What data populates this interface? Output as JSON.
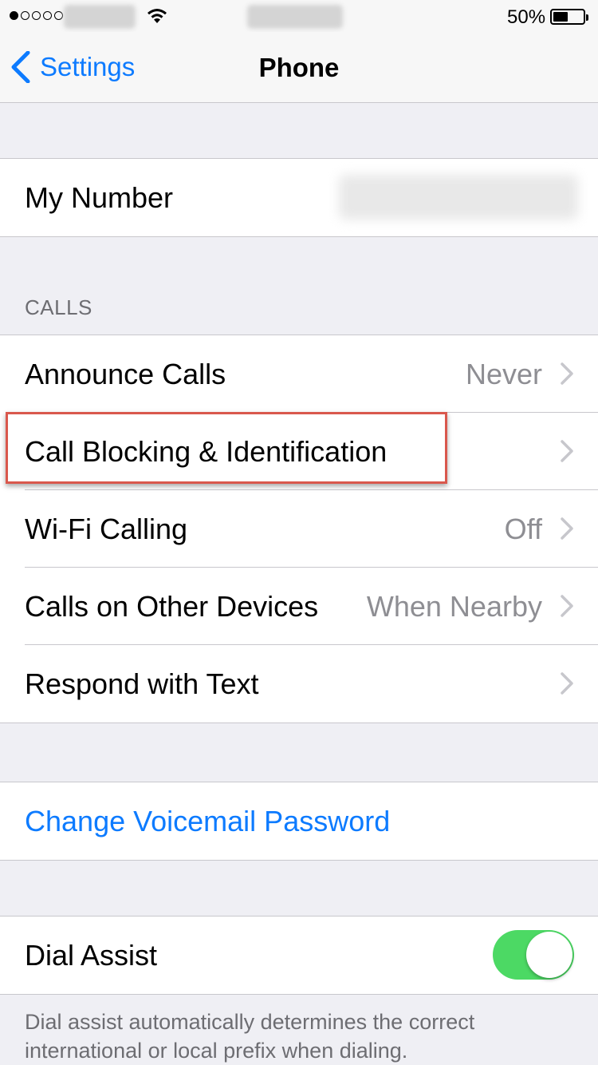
{
  "status_bar": {
    "signal_bars_filled": 1,
    "signal_bars_total": 5,
    "battery_percent": "50%",
    "battery_level": 0.5
  },
  "nav": {
    "back_label": "Settings",
    "title": "Phone"
  },
  "my_number": {
    "label": "My Number"
  },
  "calls_section": {
    "header": "CALLS",
    "rows": [
      {
        "label": "Announce Calls",
        "value": "Never"
      },
      {
        "label": "Call Blocking & Identification",
        "value": ""
      },
      {
        "label": "Wi-Fi Calling",
        "value": "Off"
      },
      {
        "label": "Calls on Other Devices",
        "value": "When Nearby"
      },
      {
        "label": "Respond with Text",
        "value": ""
      }
    ]
  },
  "voicemail": {
    "label": "Change Voicemail Password"
  },
  "dial_assist": {
    "label": "Dial Assist",
    "enabled": true,
    "note": "Dial assist automatically determines the correct international or local prefix when dialing."
  },
  "colors": {
    "accent": "#0d7bff",
    "toggle_on": "#4cd964",
    "highlight": "#d9584d"
  }
}
